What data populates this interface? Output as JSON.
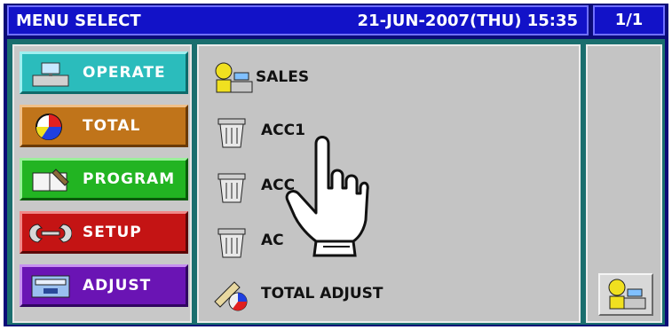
{
  "header": {
    "title": "MENU SELECT",
    "datetime": "21-JUN-2007(THU) 15:35",
    "page": "1/1"
  },
  "sidebar": {
    "items": [
      {
        "label": "OPERATE",
        "icon": "scale-icon",
        "color": "#2bbcbc"
      },
      {
        "label": "TOTAL",
        "icon": "pie-chart-icon",
        "color": "#c0741a"
      },
      {
        "label": "PROGRAM",
        "icon": "notebook-icon",
        "color": "#22b422"
      },
      {
        "label": "SETUP",
        "icon": "wrench-icon",
        "color": "#c41414"
      },
      {
        "label": "ADJUST",
        "icon": "keyboard-icon",
        "color": "#6a14b4"
      }
    ]
  },
  "main": {
    "items": [
      {
        "label": "SALES",
        "icon": "operator-scale-icon"
      },
      {
        "label": "ACC1",
        "icon": "trash-bin-icon"
      },
      {
        "label": "ACC",
        "icon": "trash-bin-icon"
      },
      {
        "label": "AC",
        "icon": "trash-bin-icon"
      },
      {
        "label": "TOTAL ADJUST",
        "icon": "pencil-chart-icon"
      }
    ]
  },
  "right": {
    "button_icon": "operator-scale-icon"
  }
}
